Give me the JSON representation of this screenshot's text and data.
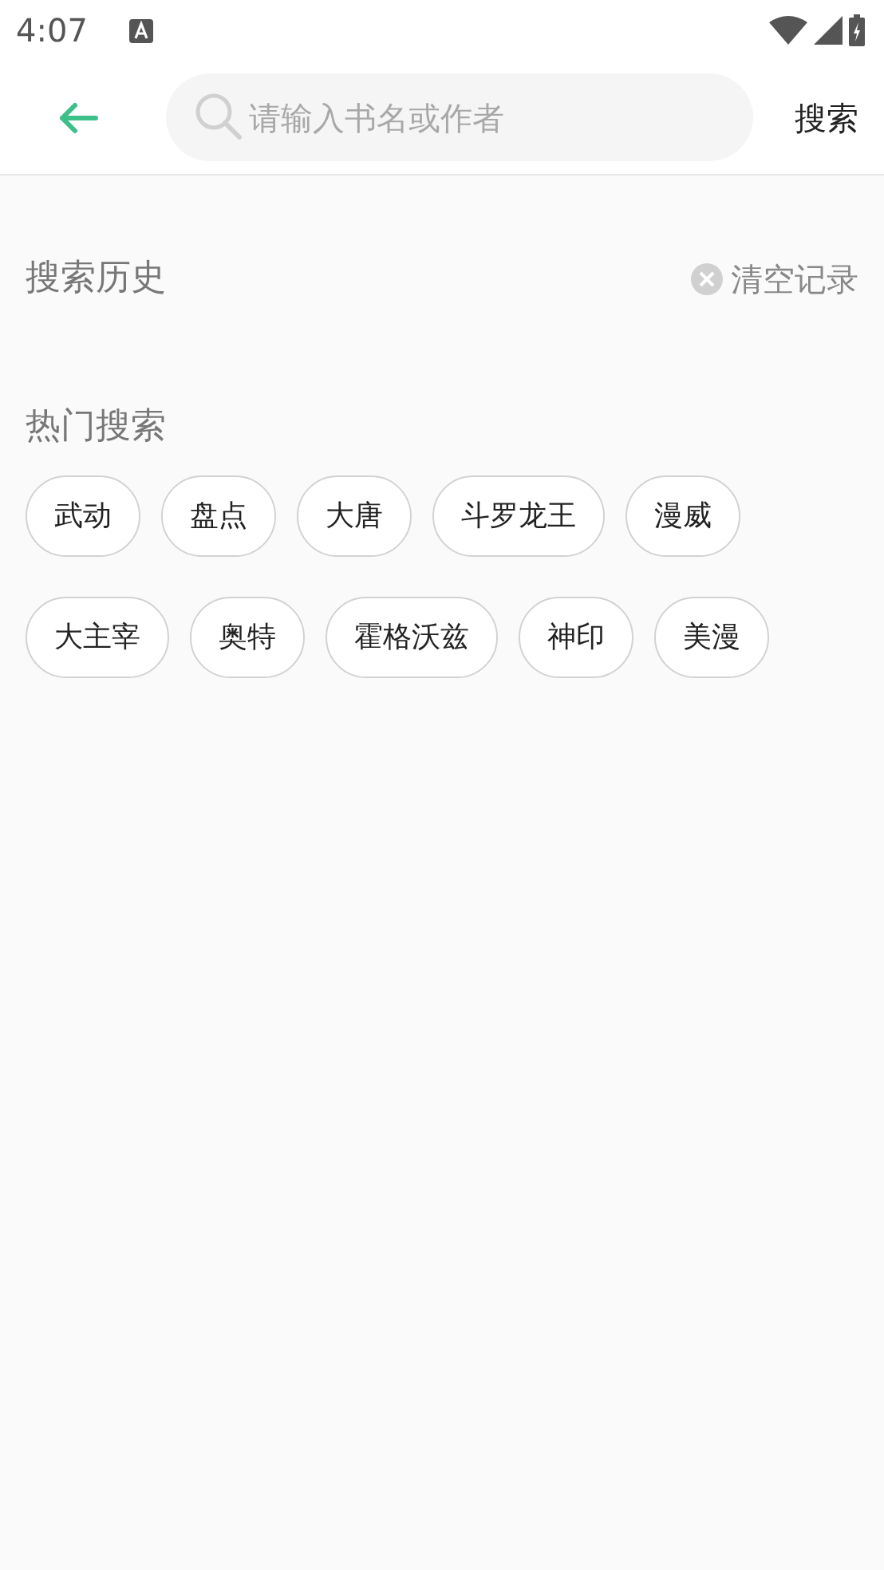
{
  "status_bar": {
    "time": "4:07"
  },
  "search_bar": {
    "placeholder": "请输入书名或作者",
    "button": "搜索"
  },
  "history": {
    "title": "搜索历史",
    "clear": "清空记录"
  },
  "hot": {
    "title": "热门搜索",
    "tags": [
      "武动",
      "盘点",
      "大唐",
      "斗罗龙王",
      "漫威",
      "大主宰",
      "奥特",
      "霍格沃兹",
      "神印",
      "美漫"
    ]
  }
}
